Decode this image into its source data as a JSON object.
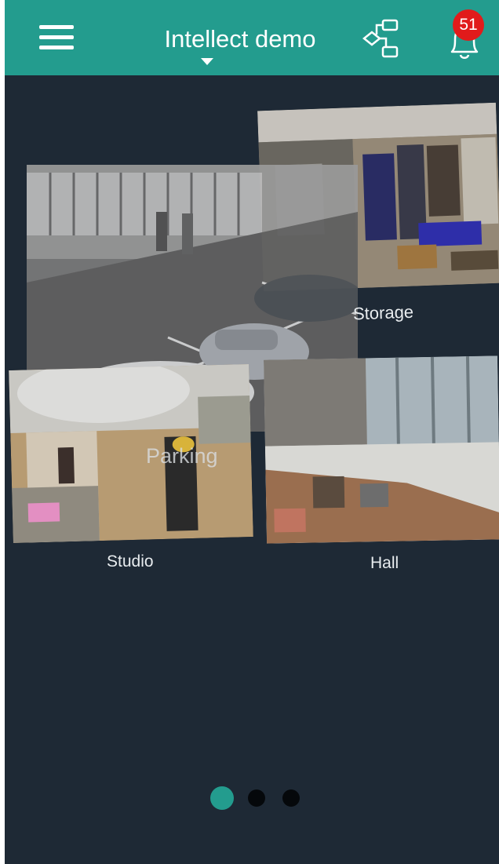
{
  "header": {
    "title": "Intellect demo",
    "notification_count": "51"
  },
  "cameras": [
    {
      "name": "Storage"
    },
    {
      "name": "Parking"
    },
    {
      "name": "Studio"
    },
    {
      "name": "Hall"
    }
  ],
  "pagination": {
    "pages": 3,
    "current": 1
  },
  "colors": {
    "header": "#239c8e",
    "background": "#1e2935",
    "badge": "#e11b1b",
    "active_dot": "#239c8e"
  }
}
